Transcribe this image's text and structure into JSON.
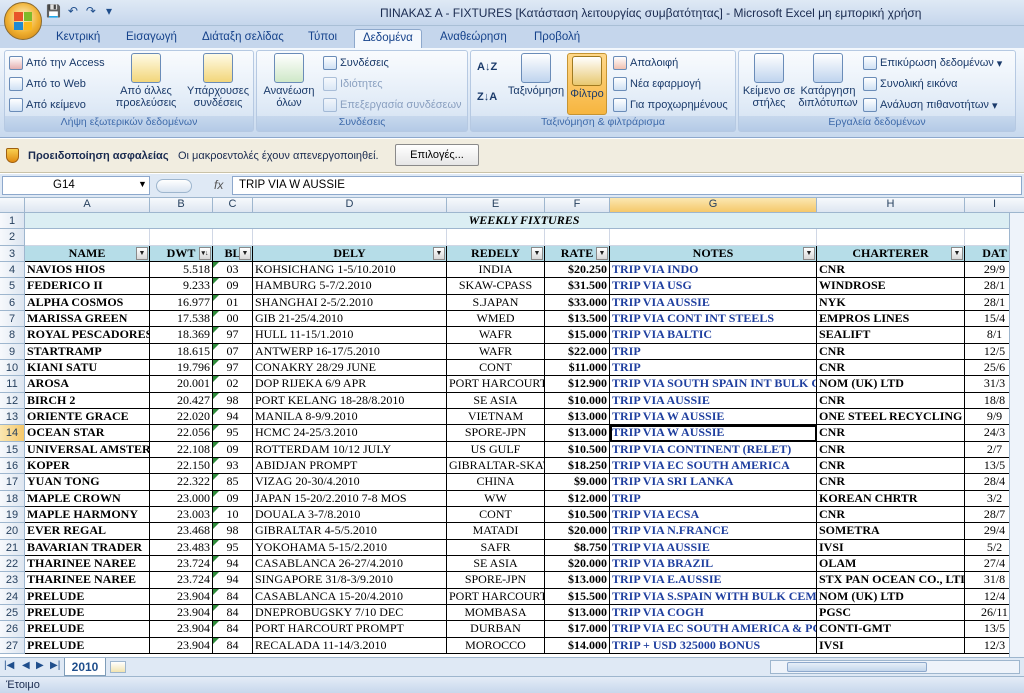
{
  "window": {
    "title": "ΠΙΝΑΚΑΣ Α - FIXTURES  [Κατάσταση λειτουργίας συμβατότητας] - Microsoft Excel μη εμπορική χρήση"
  },
  "tabs": [
    "Κεντρική",
    "Εισαγωγή",
    "Διάταξη σελίδας",
    "Τύποι",
    "Δεδομένα",
    "Αναθεώρηση",
    "Προβολή"
  ],
  "ribbon": {
    "external": {
      "title": "Λήψη εξωτερικών δεδομένων",
      "from_access": "Από την Access",
      "from_web": "Από το Web",
      "from_text": "Από κείμενο",
      "other_sources": "Από άλλες προελεύσεις",
      "existing": "Υπάρχουσες συνδέσεις"
    },
    "connections": {
      "title": "Συνδέσεις",
      "refresh_all": "Ανανέωση όλων",
      "connections": "Συνδέσεις",
      "properties": "Ιδιότητες",
      "edit_links": "Επεξεργασία συνδέσεων"
    },
    "sort": {
      "title": "Ταξινόμηση & φιλτράρισμα",
      "sort": "Ταξινόμηση",
      "filter": "Φίλτρο",
      "clear": "Απαλοιφή",
      "reapply": "Νέα εφαρμογή",
      "advanced": "Για προχωρημένους"
    },
    "tools": {
      "title": "Εργαλεία δεδομένων",
      "text_to_columns": "Κείμενο σε στήλες",
      "remove_duplicates": "Κατάργηση διπλότυπων",
      "validation": "Επικύρωση δεδομένων",
      "consolidate": "Συνολική εικόνα",
      "whatif": "Ανάλυση πιθανοτήτων"
    }
  },
  "security": {
    "label": "Προειδοποίηση ασφαλείας",
    "message": "Οι μακροεντολές έχουν απενεργοποιηθεί.",
    "options": "Επιλογές..."
  },
  "formula": {
    "cell": "G14",
    "fx": "fx",
    "value": "TRIP VIA W AUSSIE"
  },
  "columns": [
    "A",
    "B",
    "C",
    "D",
    "E",
    "F",
    "G",
    "H",
    "I"
  ],
  "sheet_title": "WEEKLY FIXTURES",
  "headers": [
    "NAME",
    "DWT",
    "BL",
    "DELY",
    "REDELY",
    "RATE",
    "NOTES",
    "CHARTERER",
    "DAT"
  ],
  "rows": [
    {
      "n": "4",
      "c": [
        "NAVIOS HIOS",
        "5.518",
        "03",
        "KOHSICHANG 1-5/10.2010",
        "INDIA",
        "$20.250",
        "TRIP VIA INDO",
        "CNR",
        "29/9"
      ]
    },
    {
      "n": "5",
      "c": [
        "FEDERICO II",
        "9.233",
        "09",
        "HAMBURG 5-7/2.2010",
        "SKAW-CPASS",
        "$31.500",
        "TRIP VIA USG",
        "WINDROSE",
        "28/1"
      ]
    },
    {
      "n": "6",
      "c": [
        "ALPHA COSMOS",
        "16.977",
        "01",
        "SHANGHAI 2-5/2.2010",
        "S.JAPAN",
        "$33.000",
        "TRIP VIA AUSSIE",
        "NYK",
        "28/1"
      ]
    },
    {
      "n": "7",
      "c": [
        "MARISSA GREEN",
        "17.538",
        "00",
        "GIB 21-25/4.2010",
        "WMED",
        "$13.500",
        "TRIP VIA CONT INT STEELS",
        "EMPROS LINES",
        "15/4"
      ]
    },
    {
      "n": "8",
      "c": [
        "ROYAL PESCADORES",
        "18.369",
        "97",
        "HULL 11-15/1.2010",
        "WAFR",
        "$15.000",
        "TRIP VIA BALTIC",
        "SEALIFT",
        "8/1"
      ]
    },
    {
      "n": "9",
      "c": [
        "STARTRAMP",
        "18.615",
        "07",
        "ANTWERP 16-17/5.2010",
        "WAFR",
        "$22.000",
        "TRIP",
        "CNR",
        "12/5"
      ]
    },
    {
      "n": "10",
      "c": [
        "KIANI SATU",
        "19.796",
        "97",
        "CONAKRY 28/29 JUNE",
        "CONT",
        "$11.000",
        "TRIP",
        "CNR",
        "25/6"
      ]
    },
    {
      "n": "11",
      "c": [
        "AROSA",
        "20.001",
        "02",
        "DOP RIJEKA 6/9 APR",
        "PORT HARCOURT",
        "$12.900",
        "TRIP VIA SOUTH SPAIN INT BULK CEMENT",
        "NOM (UK) LTD",
        "31/3"
      ]
    },
    {
      "n": "12",
      "c": [
        "BIRCH 2",
        "20.427",
        "98",
        "PORT KELANG 18-28/8.2010",
        "SE ASIA",
        "$10.000",
        "TRIP VIA AUSSIE",
        "CNR",
        "18/8"
      ]
    },
    {
      "n": "13",
      "c": [
        "ORIENTE GRACE",
        "22.020",
        "94",
        "MANILA 8-9/9.2010",
        "VIETNAM",
        "$13.000",
        "TRIP VIA W AUSSIE",
        "ONE STEEL RECYCLING",
        "9/9"
      ]
    },
    {
      "n": "14",
      "c": [
        "OCEAN STAR",
        "22.056",
        "95",
        "HCMC 24-25/3.2010",
        "SPORE-JPN",
        "$13.000",
        "TRIP VIA W AUSSIE",
        "CNR",
        "24/3"
      ]
    },
    {
      "n": "15",
      "c": [
        "UNIVERSAL AMSTERDAM",
        "22.108",
        "09",
        "ROTTERDAM 10/12 JULY",
        "US GULF",
        "$10.500",
        "TRIP VIA CONTINENT (RELET)",
        "CNR",
        "2/7"
      ]
    },
    {
      "n": "16",
      "c": [
        "KOPER",
        "22.150",
        "93",
        "ABIDJAN PROMPT",
        "GIBRALTAR-SKAW",
        "$18.250",
        "TRIP VIA EC SOUTH AMERICA",
        "CNR",
        "13/5"
      ]
    },
    {
      "n": "17",
      "c": [
        "YUAN TONG",
        "22.322",
        "85",
        "VIZAG 20-30/4.2010",
        "CHINA",
        "$9.000",
        "TRIP VIA SRI LANKA",
        "CNR",
        "28/4"
      ]
    },
    {
      "n": "18",
      "c": [
        "MAPLE CROWN",
        "23.000",
        "09",
        "JAPAN 15-20/2.2010 7-8 MOS",
        "WW",
        "$12.000",
        "TRIP",
        "KOREAN CHRTR",
        "3/2"
      ]
    },
    {
      "n": "19",
      "c": [
        "MAPLE HARMONY",
        "23.003",
        "10",
        "DOUALA 3-7/8.2010",
        "CONT",
        "$10.500",
        "TRIP VIA ECSA",
        "CNR",
        "28/7"
      ]
    },
    {
      "n": "20",
      "c": [
        "EVER REGAL",
        "23.468",
        "98",
        "GIBRALTAR 4-5/5.2010",
        "MATADI",
        "$20.000",
        "TRIP VIA N.FRANCE",
        "SOMETRA",
        "29/4"
      ]
    },
    {
      "n": "21",
      "c": [
        "BAVARIAN TRADER",
        "23.483",
        "95",
        "YOKOHAMA 5-15/2.2010",
        "SAFR",
        "$8.750",
        "TRIP VIA AUSSIE",
        "IVSI",
        "5/2"
      ]
    },
    {
      "n": "22",
      "c": [
        "THARINEE NAREE",
        "23.724",
        "94",
        "CASABLANCA 26-27/4.2010",
        "SE ASIA",
        "$20.000",
        "TRIP VIA BRAZIL",
        "OLAM",
        "27/4"
      ]
    },
    {
      "n": "23",
      "c": [
        "THARINEE NAREE",
        "23.724",
        "94",
        "SINGAPORE 31/8-3/9.2010",
        "SPORE-JPN",
        "$13.000",
        "TRIP VIA E.AUSSIE",
        "STX PAN OCEAN CO., LTD",
        "31/8"
      ]
    },
    {
      "n": "24",
      "c": [
        "PRELUDE",
        "23.904",
        "84",
        "CASABLANCA 15-20/4.2010",
        "PORT HARCOURT",
        "$15.500",
        "TRIP VIA S.SPAIN WITH BULK CEMENT",
        "NOM (UK) LTD",
        "12/4"
      ]
    },
    {
      "n": "25",
      "c": [
        "PRELUDE",
        "23.904",
        "84",
        "DNEPROBUGSKY 7/10 DEC",
        "MOMBASA",
        "$13.000",
        "TRIP VIA COGH",
        "PGSC",
        "26/11"
      ]
    },
    {
      "n": "26",
      "c": [
        "PRELUDE",
        "23.904",
        "84",
        "PORT HARCOURT PROMPT",
        "DURBAN",
        "$17.000",
        "TRIP VIA EC SOUTH AMERICA & PG",
        "CONTI-GMT",
        "13/5"
      ]
    },
    {
      "n": "27",
      "c": [
        "PRELUDE",
        "23.904",
        "84",
        "RECALADA 11-14/3.2010",
        "MOROCCO",
        "$14.000",
        "TRIP + USD 325000 BONUS",
        "IVSI",
        "12/3"
      ]
    }
  ],
  "sheet_tab": "2010",
  "status": "Έτοιμο"
}
